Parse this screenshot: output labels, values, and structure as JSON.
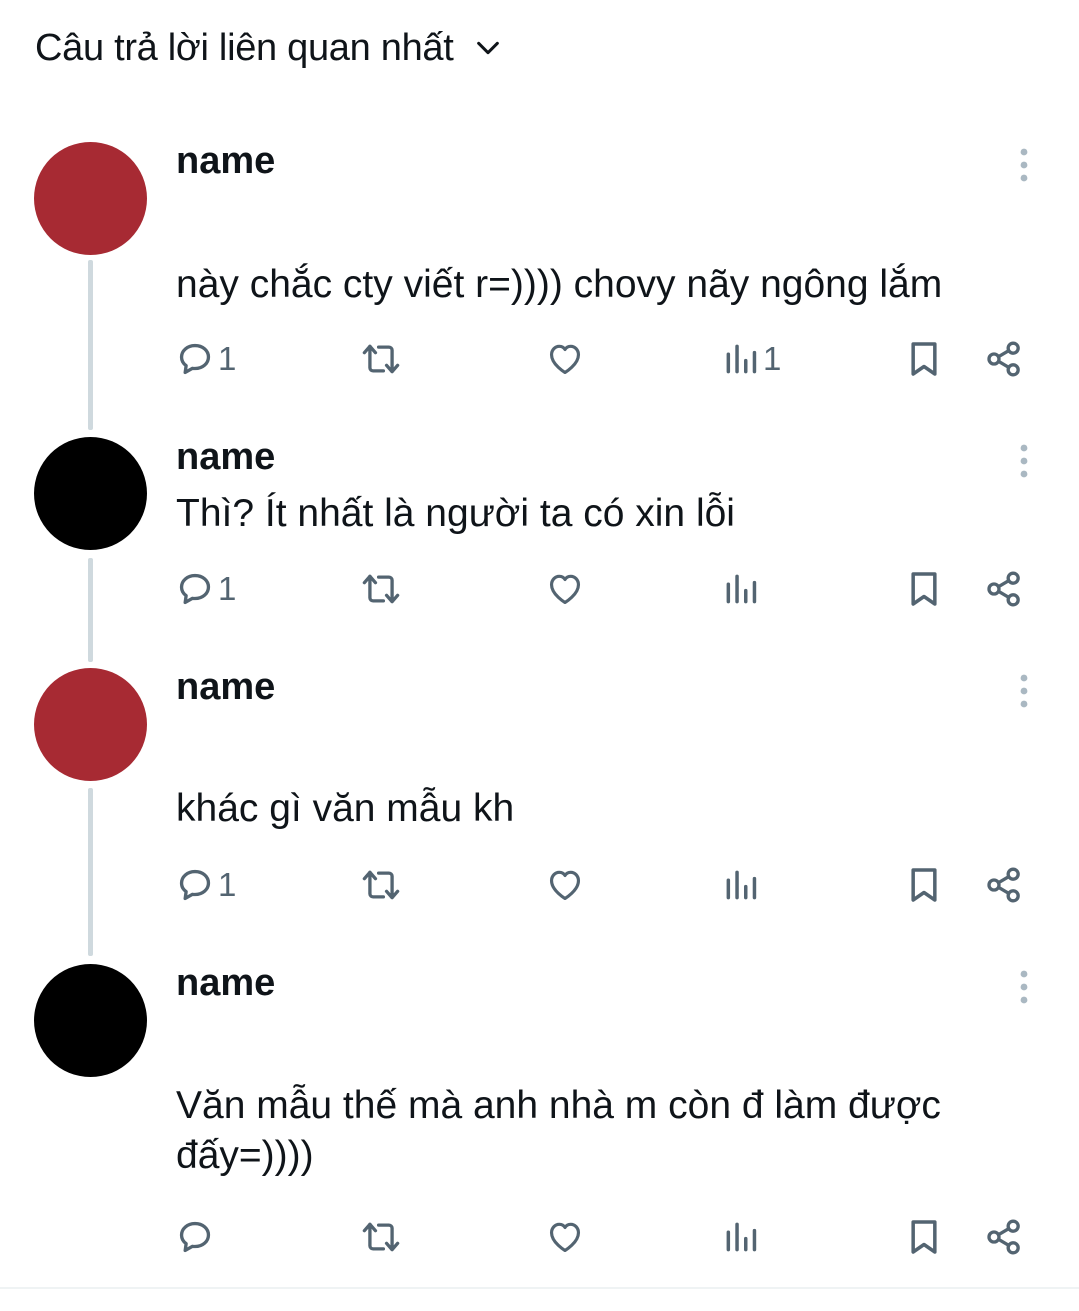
{
  "header": {
    "sort_label": "Câu trả lời liên quan nhất"
  },
  "replies": [
    {
      "author": "name",
      "text": "này chắc cty viết r=)))) chovy nãy ngông lắm",
      "avatar_color": "#a72a33",
      "reply_count": "1",
      "view_count": "1"
    },
    {
      "author": "name",
      "text": "Thì? Ít nhất là người ta có xin lỗi",
      "avatar_color": "#000000",
      "reply_count": "1",
      "view_count": ""
    },
    {
      "author": "name",
      "text": "khác gì văn mẫu kh",
      "avatar_color": "#a72a33",
      "reply_count": "1",
      "view_count": ""
    },
    {
      "author": "name",
      "text": "Văn mẫu thế mà anh nhà m còn đ làm được đấy=))))",
      "avatar_color": "#000000",
      "reply_count": "",
      "view_count": ""
    }
  ],
  "colors": {
    "icon": "#536471",
    "thread_line": "#cfd9de",
    "text": "#0f1419"
  }
}
